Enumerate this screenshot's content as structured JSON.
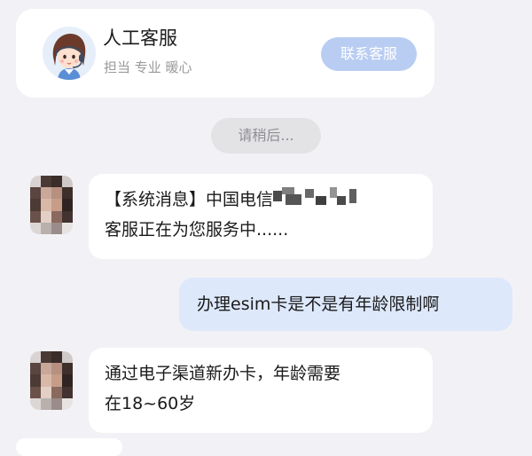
{
  "service_card": {
    "title": "人工客服",
    "subtitle": "担当 专业 暖心",
    "contact_button": "联系客服"
  },
  "status_pill": "请稍后...",
  "messages": [
    {
      "sender": "agent",
      "line1": "【系统消息】中国电信",
      "line2": "客服正在为您服务中......"
    },
    {
      "sender": "user",
      "text": "办理esim卡是不是有年龄限制啊"
    },
    {
      "sender": "agent",
      "line1": "通过电子渠道新办卡，年龄需要",
      "line2": "在18~60岁"
    }
  ],
  "colors": {
    "background": "#f2f2f6",
    "user_bubble": "#dde8fb",
    "contact_button": "#b9cdf3"
  }
}
